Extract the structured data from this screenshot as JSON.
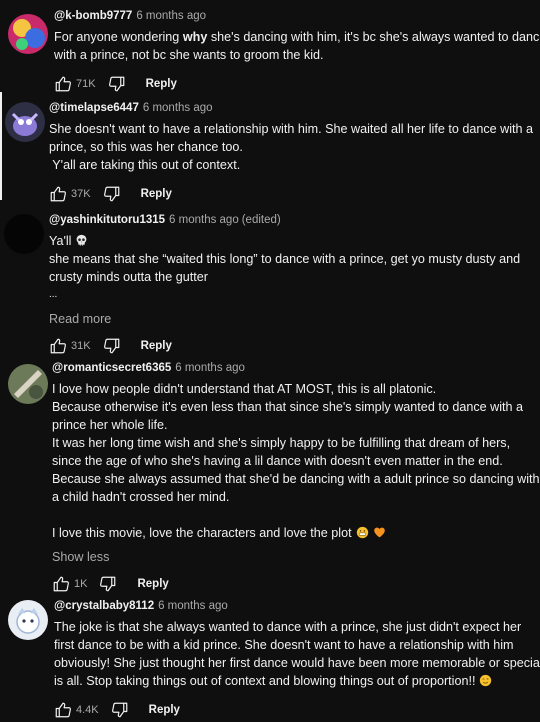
{
  "comments": [
    {
      "handle": "@k-bomb9777",
      "time": "6 months ago",
      "lines": [
        "For anyone wondering |why| she's dancing with him, it's bc she's always wanted to dance",
        "with a prince, not bc she wants to groom the kid."
      ],
      "likes": "71K",
      "reply": "Reply"
    },
    {
      "handle": "@timelapse6447",
      "time": "6 months ago",
      "lines": [
        "She doesn't want to have a relationship with him.  She waited all her life to dance with a",
        "prince, so this was her chance too.",
        " Y'all are taking this out of context."
      ],
      "likes": "37K",
      "reply": "Reply"
    },
    {
      "handle": "@yashinkitutoru1315",
      "time": "6 months ago",
      "edited": "(edited)",
      "first_line": "Ya'll",
      "lines": [
        "she means that she “waited this long” to dance with a prince, get yo musty dusty and",
        "crusty minds outta the gutter",
        "..."
      ],
      "more": "Read more",
      "likes": "31K",
      "reply": "Reply"
    },
    {
      "handle": "@romanticsecret6365",
      "time": "6 months ago",
      "lines": [
        "I love how people didn't understand that AT MOST, this is all platonic.",
        "Because otherwise it's even less than that since she's simply wanted to dance with a",
        "prince her whole life.",
        "It was her long time wish and she's simply happy to be fulfilling that dream of hers,",
        "since the age of who she's having a lil dance with doesn't even matter in the end.",
        "Because she always assumed that she'd be dancing with a adult prince so dancing with",
        "a child hadn't crossed her mind.",
        ""
      ],
      "last_line": "I love this movie, love the characters and love the plot",
      "more": "Show less",
      "likes": "1K",
      "reply": "Reply"
    },
    {
      "handle": "@crystalbaby8112",
      "time": "6 months ago",
      "lines": [
        "The joke is that she always wanted to dance with a prince, she just didn't expect her",
        "first dance to be with a kid prince. She doesn't want to have a relationship with him",
        "obviously! She just thought her first dance would have been more memorable or special"
      ],
      "last_line": "is all. Stop taking things out of context and blowing things out of proportion!!",
      "likes": "4.4K",
      "reply": "Reply"
    }
  ],
  "colors": {
    "background": "#0f0f0f",
    "text": "#f1f1f1",
    "muted": "#aaaaaa"
  },
  "icons": [
    "thumb-up-icon",
    "thumb-down-icon",
    "skull-emoji",
    "grimace-emoji",
    "orange-heart-emoji",
    "blush-emoji"
  ]
}
